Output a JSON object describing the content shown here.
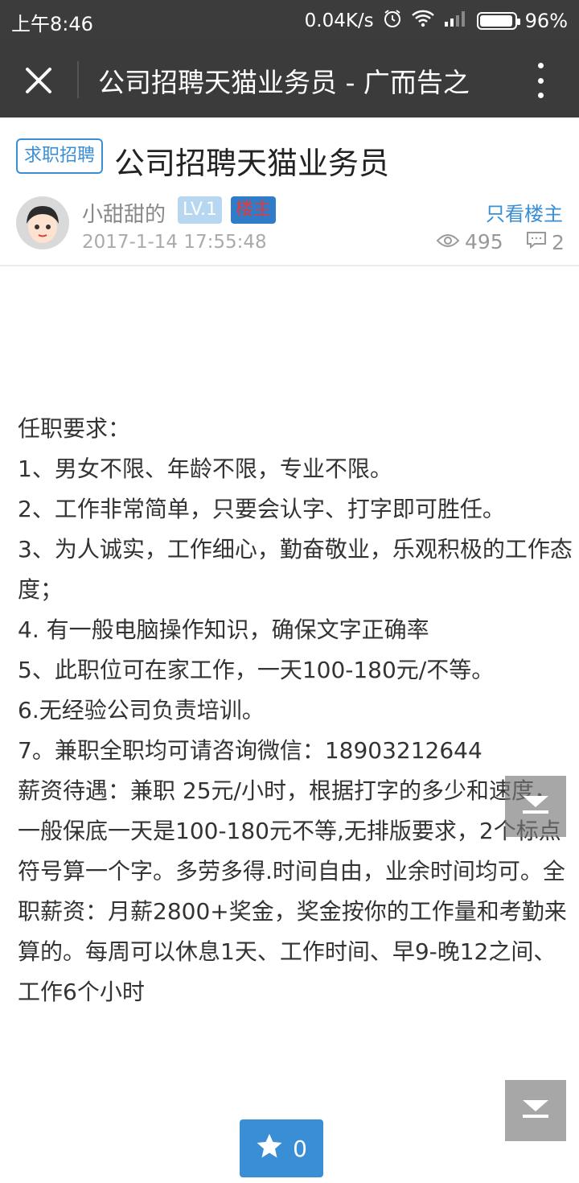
{
  "status_bar": {
    "time": "上午8:46",
    "speed": "0.04K/s",
    "battery_level": 0.96,
    "battery_text": "96%"
  },
  "nav": {
    "title": "公司招聘天猫业务员 - 广而告之",
    "close_icon": "close-icon",
    "more_icon": "more-vertical-icon"
  },
  "post": {
    "tag": "求职招聘",
    "title": "公司招聘天猫业务员",
    "author": "小甜甜的",
    "level": "LV.1",
    "owner_badge": "楼主",
    "only_owner": "只看楼主",
    "time": "2017-1-14 17:55:48",
    "views": "495",
    "comments": "2",
    "body": [
      "任职要求：",
      "1、男女不限、年龄不限，专业不限。",
      "2、工作非常简单，只要会认字、打字即可胜任。",
      "3、为人诚实，工作细心，勤奋敬业，乐观积极的工作态度；",
      "4. 有一般电脑操作知识，确保文字正确率",
      "5、此职位可在家工作，一天100-180元/不等。",
      "6.无经验公司负责培训。",
      "7。兼职全职均可请咨询微信：18903212644",
      "薪资待遇：兼职 25元/小时，根据打字的多少和速度，一般保底一天是100-180元不等,无排版要求，2个标点符号算一个字。多劳多得.时间自由，业余时间均可。全职薪资：月薪2800+奖金，奖金按你的工作量和考勤来算的。每周可以休息1天、工作时间、早9-晚12之间、工作6个小时"
    ]
  },
  "actions": {
    "favorites": "0",
    "fav_icon": "star-icon",
    "scroll_icon": "scroll-down-icon"
  },
  "colors": {
    "nav_bg": "#3b3b3b",
    "accent": "#3a8ed6",
    "owner_text": "#e23a3a"
  }
}
